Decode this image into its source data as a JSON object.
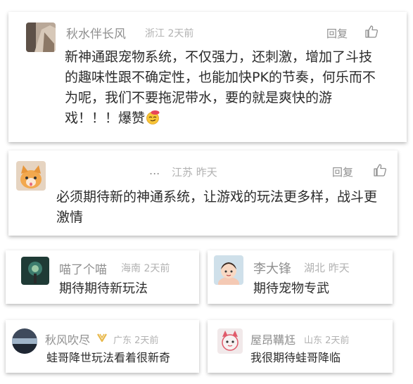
{
  "comments": [
    {
      "name": "秋水伴长风",
      "location": "浙江",
      "time": "2天前",
      "reply_label": "回复",
      "text": "新神通跟宠物系统，不仅强力，还刺激，增加了斗技的趣味性跟不确定性，也能加快PK的节奏，何乐而不为呢，我们不要拖泥带水，要的就是爽快的游戏！！！爆赞",
      "emoji": "smirk-666-emoji"
    },
    {
      "name": "...",
      "location": "江苏",
      "time": "昨天",
      "reply_label": "回复",
      "text": "必须期待新的神通系统，让游戏的玩法更多样，战斗更激情"
    },
    {
      "name": "喵了个喵",
      "location": "海南",
      "time": "2天前",
      "text": "期待期待新玩法"
    },
    {
      "name": "李大锋",
      "location": "湖北",
      "time": "昨天",
      "text": "期待宠物专武"
    },
    {
      "name": "秋风吹尽",
      "location": "广东",
      "time": "2天前",
      "text": "蛙哥降世玩法看着很新奇",
      "badge": "vip-badge-icon"
    },
    {
      "name": "屋昂鞲尪",
      "location": "山东",
      "time": "2天前",
      "text": "我很期待蛙哥降临"
    }
  ],
  "icons": [
    "thumb-up-icon"
  ],
  "colors": {
    "name": "#8f8f8f",
    "location": "#b2b2b2",
    "text": "#2b2b2b",
    "badge": "#e8b84a"
  }
}
